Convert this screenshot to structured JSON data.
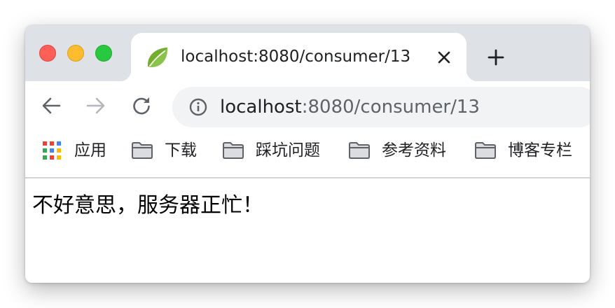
{
  "window": {
    "controls": {
      "close_color": "#fe5f57",
      "minimize_color": "#febc2e",
      "zoom_color": "#28c840"
    }
  },
  "tab": {
    "favicon": "spring-leaf-icon",
    "title": "localhost:8080/consumer/13",
    "close_icon": "close-icon"
  },
  "new_tab_icon": "plus-icon",
  "toolbar": {
    "back_icon": "arrow-left-icon",
    "forward_icon": "arrow-right-icon",
    "reload_icon": "reload-icon",
    "site_info_icon": "info-icon",
    "url_host": "localhost",
    "url_rest": ":8080/consumer/13"
  },
  "bookmarks": [
    {
      "label": "应用",
      "icon": "apps-grid-icon"
    },
    {
      "label": "下载",
      "icon": "folder-icon"
    },
    {
      "label": "踩坑问题",
      "icon": "folder-icon"
    },
    {
      "label": "参考资料",
      "icon": "folder-icon"
    },
    {
      "label": "博客专栏",
      "icon": "folder-icon"
    }
  ],
  "page": {
    "message": "不好意思，服务器正忙！"
  },
  "colors": {
    "tabstrip": "#dee1e6",
    "omnibox": "#f1f3f4",
    "text": "#202124",
    "muted": "#5f6368"
  }
}
